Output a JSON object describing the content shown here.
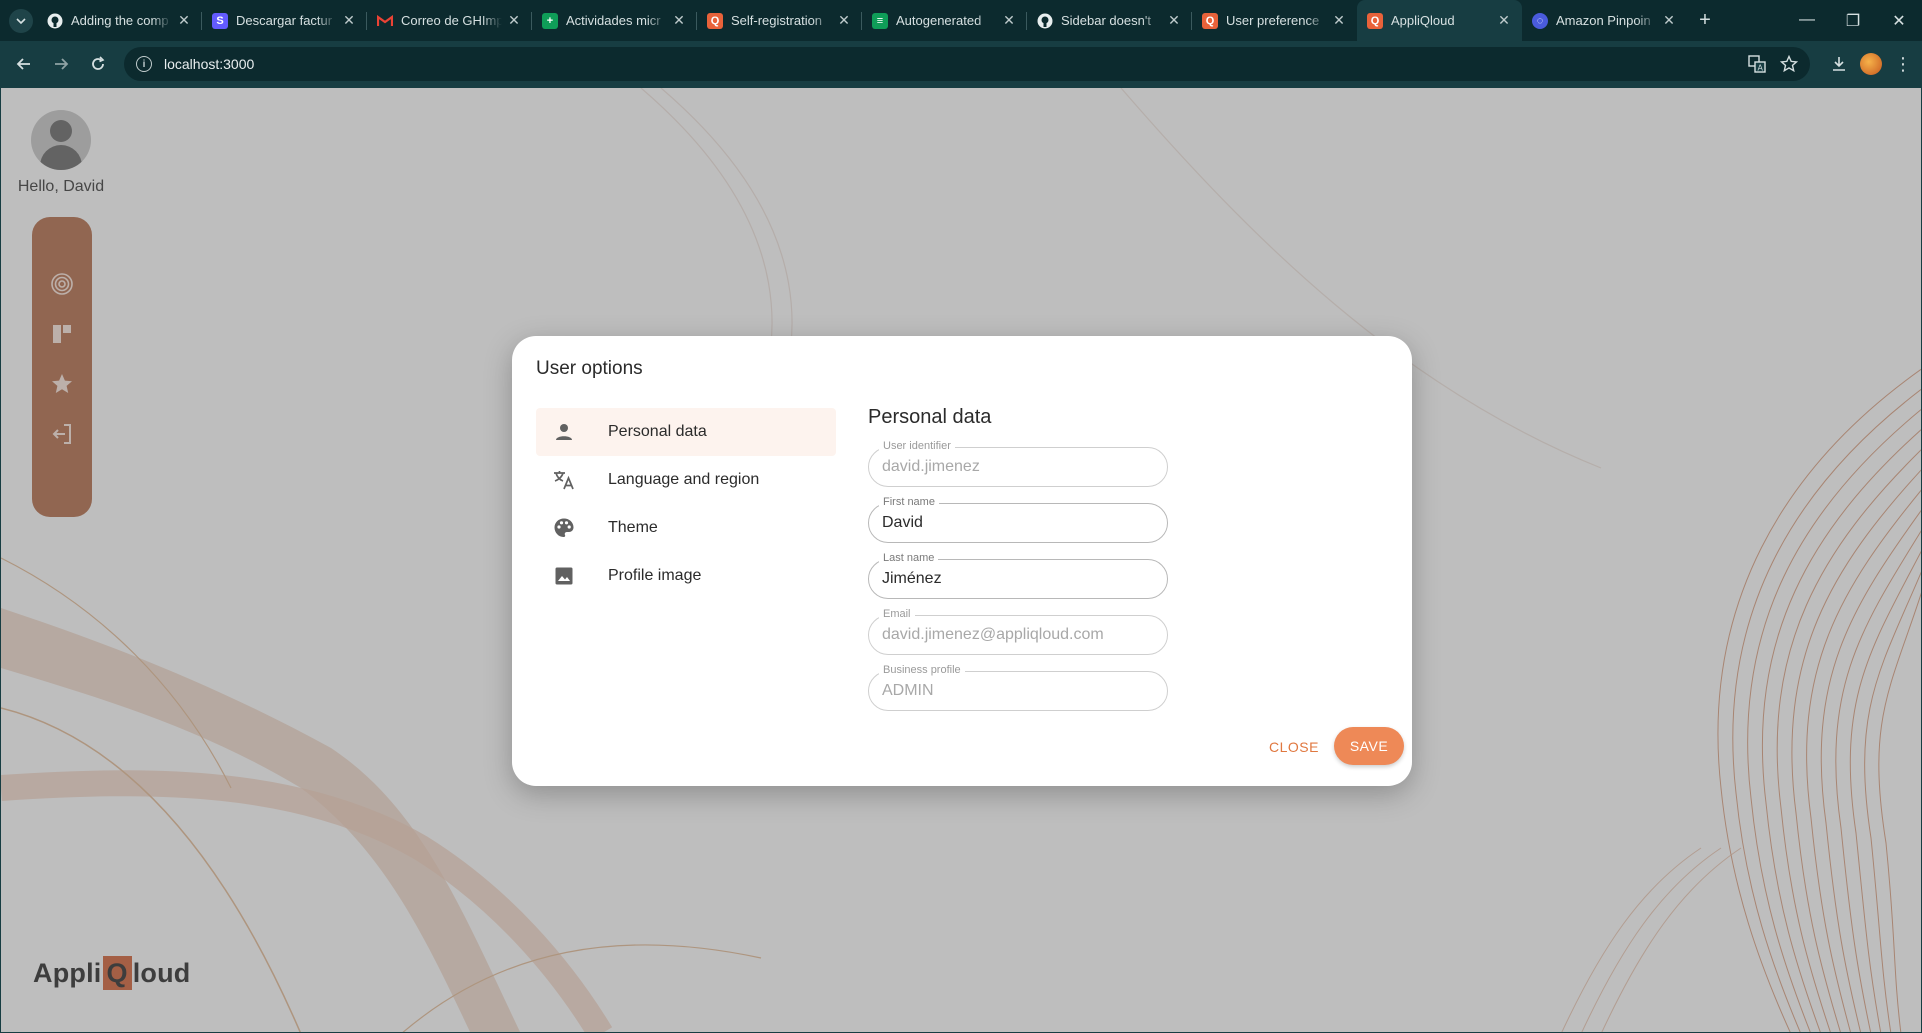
{
  "browser": {
    "tabs": [
      {
        "title": "Adding the comp",
        "icon": "github-icon",
        "color": "#1a1a1a"
      },
      {
        "title": "Descargar factur",
        "icon": "stripe-icon",
        "color": "#635bff"
      },
      {
        "title": "Correo de GHImp",
        "icon": "gmail-icon",
        "color": "#ea4335"
      },
      {
        "title": "Actividades micr",
        "icon": "sheets-icon",
        "color": "#0f9d58"
      },
      {
        "title": "Self-registration",
        "icon": "appliqloud-icon",
        "color": "#e8623a"
      },
      {
        "title": "Autogenerated",
        "icon": "sheets-icon",
        "color": "#0f9d58"
      },
      {
        "title": "Sidebar doesn't",
        "icon": "github-icon",
        "color": "#1a1a1a"
      },
      {
        "title": "User preference",
        "icon": "appliqloud-icon",
        "color": "#e8623a"
      },
      {
        "title": "AppliQloud",
        "icon": "appliqloud-icon",
        "color": "#e8623a",
        "active": true
      },
      {
        "title": "Amazon Pinpoin",
        "icon": "aws-icon",
        "color": "#4a5bdc"
      }
    ],
    "url": "localhost:3000"
  },
  "app": {
    "greeting": "Hello, David",
    "brand": {
      "prefix": "Appli",
      "q": "Q",
      "suffix": "loud"
    },
    "sidebar_icons": [
      "fingerprint-icon",
      "dashboard-icon",
      "star-icon",
      "logout-icon"
    ],
    "accent": "#ee8957"
  },
  "dialog": {
    "title": "User options",
    "menu": [
      {
        "label": "Personal data",
        "icon": "person-icon",
        "selected": true
      },
      {
        "label": "Language and region",
        "icon": "translate-icon"
      },
      {
        "label": "Theme",
        "icon": "palette-icon"
      },
      {
        "label": "Profile image",
        "icon": "image-icon"
      }
    ],
    "section_title": "Personal data",
    "fields": {
      "user_identifier": {
        "label": "User identifier",
        "value": "david.jimenez",
        "disabled": true
      },
      "first_name": {
        "label": "First name",
        "value": "David"
      },
      "last_name": {
        "label": "Last name",
        "value": "Jiménez"
      },
      "email": {
        "label": "Email",
        "value": "david.jimenez@appliqloud.com",
        "disabled": true
      },
      "business_profile": {
        "label": "Business profile",
        "value": "ADMIN",
        "disabled": true
      }
    },
    "close_label": "CLOSE",
    "save_label": "SAVE"
  }
}
